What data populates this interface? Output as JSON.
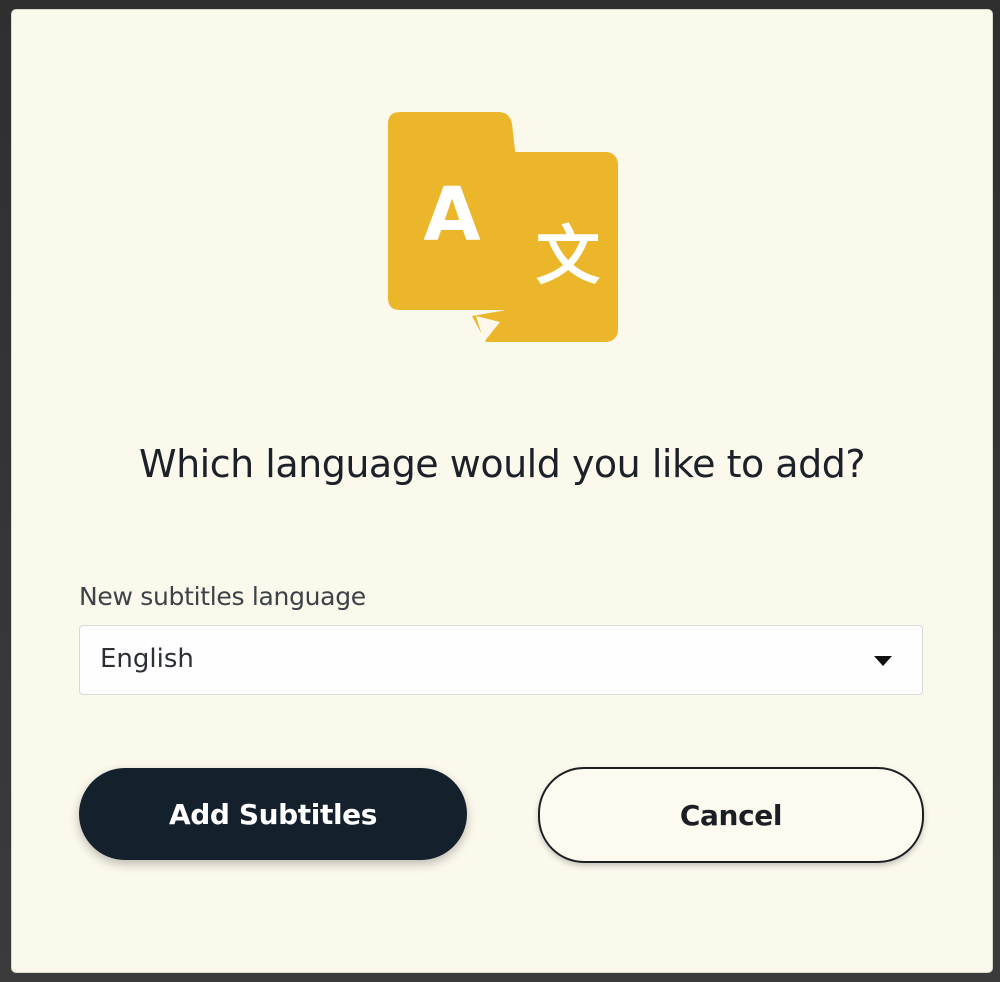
{
  "dialog": {
    "icon": "translate-icon",
    "icon_glyph_left": "A",
    "icon_glyph_right": "文",
    "accent_color": "#ebb62a",
    "title": "Which language would you like to add?",
    "field_label": "New subtitles language",
    "select": {
      "value": "English"
    },
    "buttons": {
      "primary_label": "Add Subtitles",
      "secondary_label": "Cancel"
    }
  }
}
